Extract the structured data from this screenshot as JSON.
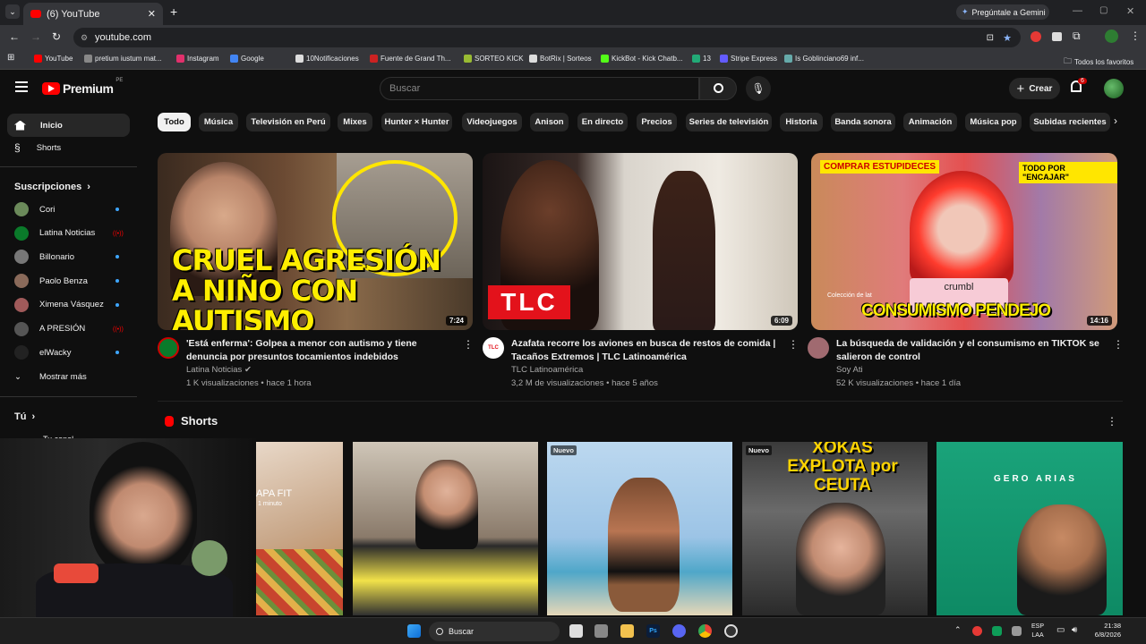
{
  "browser": {
    "tab_title": "(6) YouTube",
    "gemini": "Pregúntale a Gemini",
    "url": "youtube.com",
    "bookmarks": [
      "YouTube",
      "pretium iustum mat...",
      "Instagram",
      "Google",
      "10Notificaciones",
      "Fuente de Grand Th...",
      "SORTEO KICK",
      "BotRix | Sorteos",
      "KickBot - Kick Chatb...",
      "13",
      "Stripe Express",
      "Is Goblinciano69 inf..."
    ],
    "all_bookmarks": "Todos los favoritos"
  },
  "header": {
    "logo": "Premium",
    "region": "PE",
    "search_placeholder": "Buscar",
    "create": "Crear",
    "notif_count": "6"
  },
  "chips": [
    "Todo",
    "Música",
    "Televisión en Perú",
    "Mixes",
    "Hunter × Hunter",
    "Videojuegos",
    "Anison",
    "En directo",
    "Precios",
    "Series de televisión",
    "Historia",
    "Banda sonora",
    "Animación",
    "Música pop",
    "Subidas recientes"
  ],
  "sidebar": {
    "home": "Inicio",
    "shorts": "Shorts",
    "subs_heading": "Suscripciones",
    "subs": [
      "Cori",
      "Latina Noticias",
      "Billonario",
      "Paolo Benza",
      "Ximena Vásquez",
      "A PRESIÓN",
      "elWacky"
    ],
    "more": "Mostrar más",
    "you": "Tú",
    "channel": "Tu canal"
  },
  "videos": [
    {
      "thumb_text": "CRUEL AGRESIÓN A NIÑO CON AUTISMO",
      "duration": "7:24",
      "title": "'Está enferma': Golpea a menor con autismo y tiene denuncia por presuntos tocamientos indebidos",
      "channel": "Latina Noticias",
      "stats": "1 K visualizaciones • hace 1 hora"
    },
    {
      "thumb_text": "TLC",
      "duration": "6:09",
      "title": "Azafata recorre los aviones en busca de restos de comida | Tacaños Extremos | TLC Latinoamérica",
      "channel": "TLC Latinoamérica",
      "stats": "3,2 M de visualizaciones • hace 5 años"
    },
    {
      "thumb_text": "CONSUMISMO PENDEJO",
      "thumb_top1": "COMPRAR ESTUPIDECES",
      "thumb_top2": "TODO POR \"ENCAJAR\"",
      "brand": "crumbl",
      "caption": "Colección de lat",
      "duration": "14:16",
      "title": "La búsqueda de validación y el consumismo en TIKTOK se salieron de control",
      "channel": "Soy Ati",
      "stats": "52 K visualizaciones • hace 1 día"
    }
  ],
  "shorts": {
    "heading": "Shorts",
    "items": [
      {
        "badge": "",
        "text": "APA FIT",
        "sub": "1 minuto"
      },
      {
        "badge": "",
        "text": ""
      },
      {
        "badge": "Nuevo",
        "text": ""
      },
      {
        "badge": "Nuevo",
        "text": "XOKAS EXPLOTA por CEUTA"
      },
      {
        "badge": "",
        "text": "GERO ARIAS"
      }
    ]
  },
  "taskbar": {
    "search": "Buscar",
    "lang1": "ESP",
    "lang2": "LAA",
    "time": "21:38",
    "date": "6/8/2026"
  },
  "colors": {
    "yt_red": "#ff0000",
    "bg": "#0f0f0f",
    "chip": "#272727",
    "accent": "#3ea6ff"
  }
}
